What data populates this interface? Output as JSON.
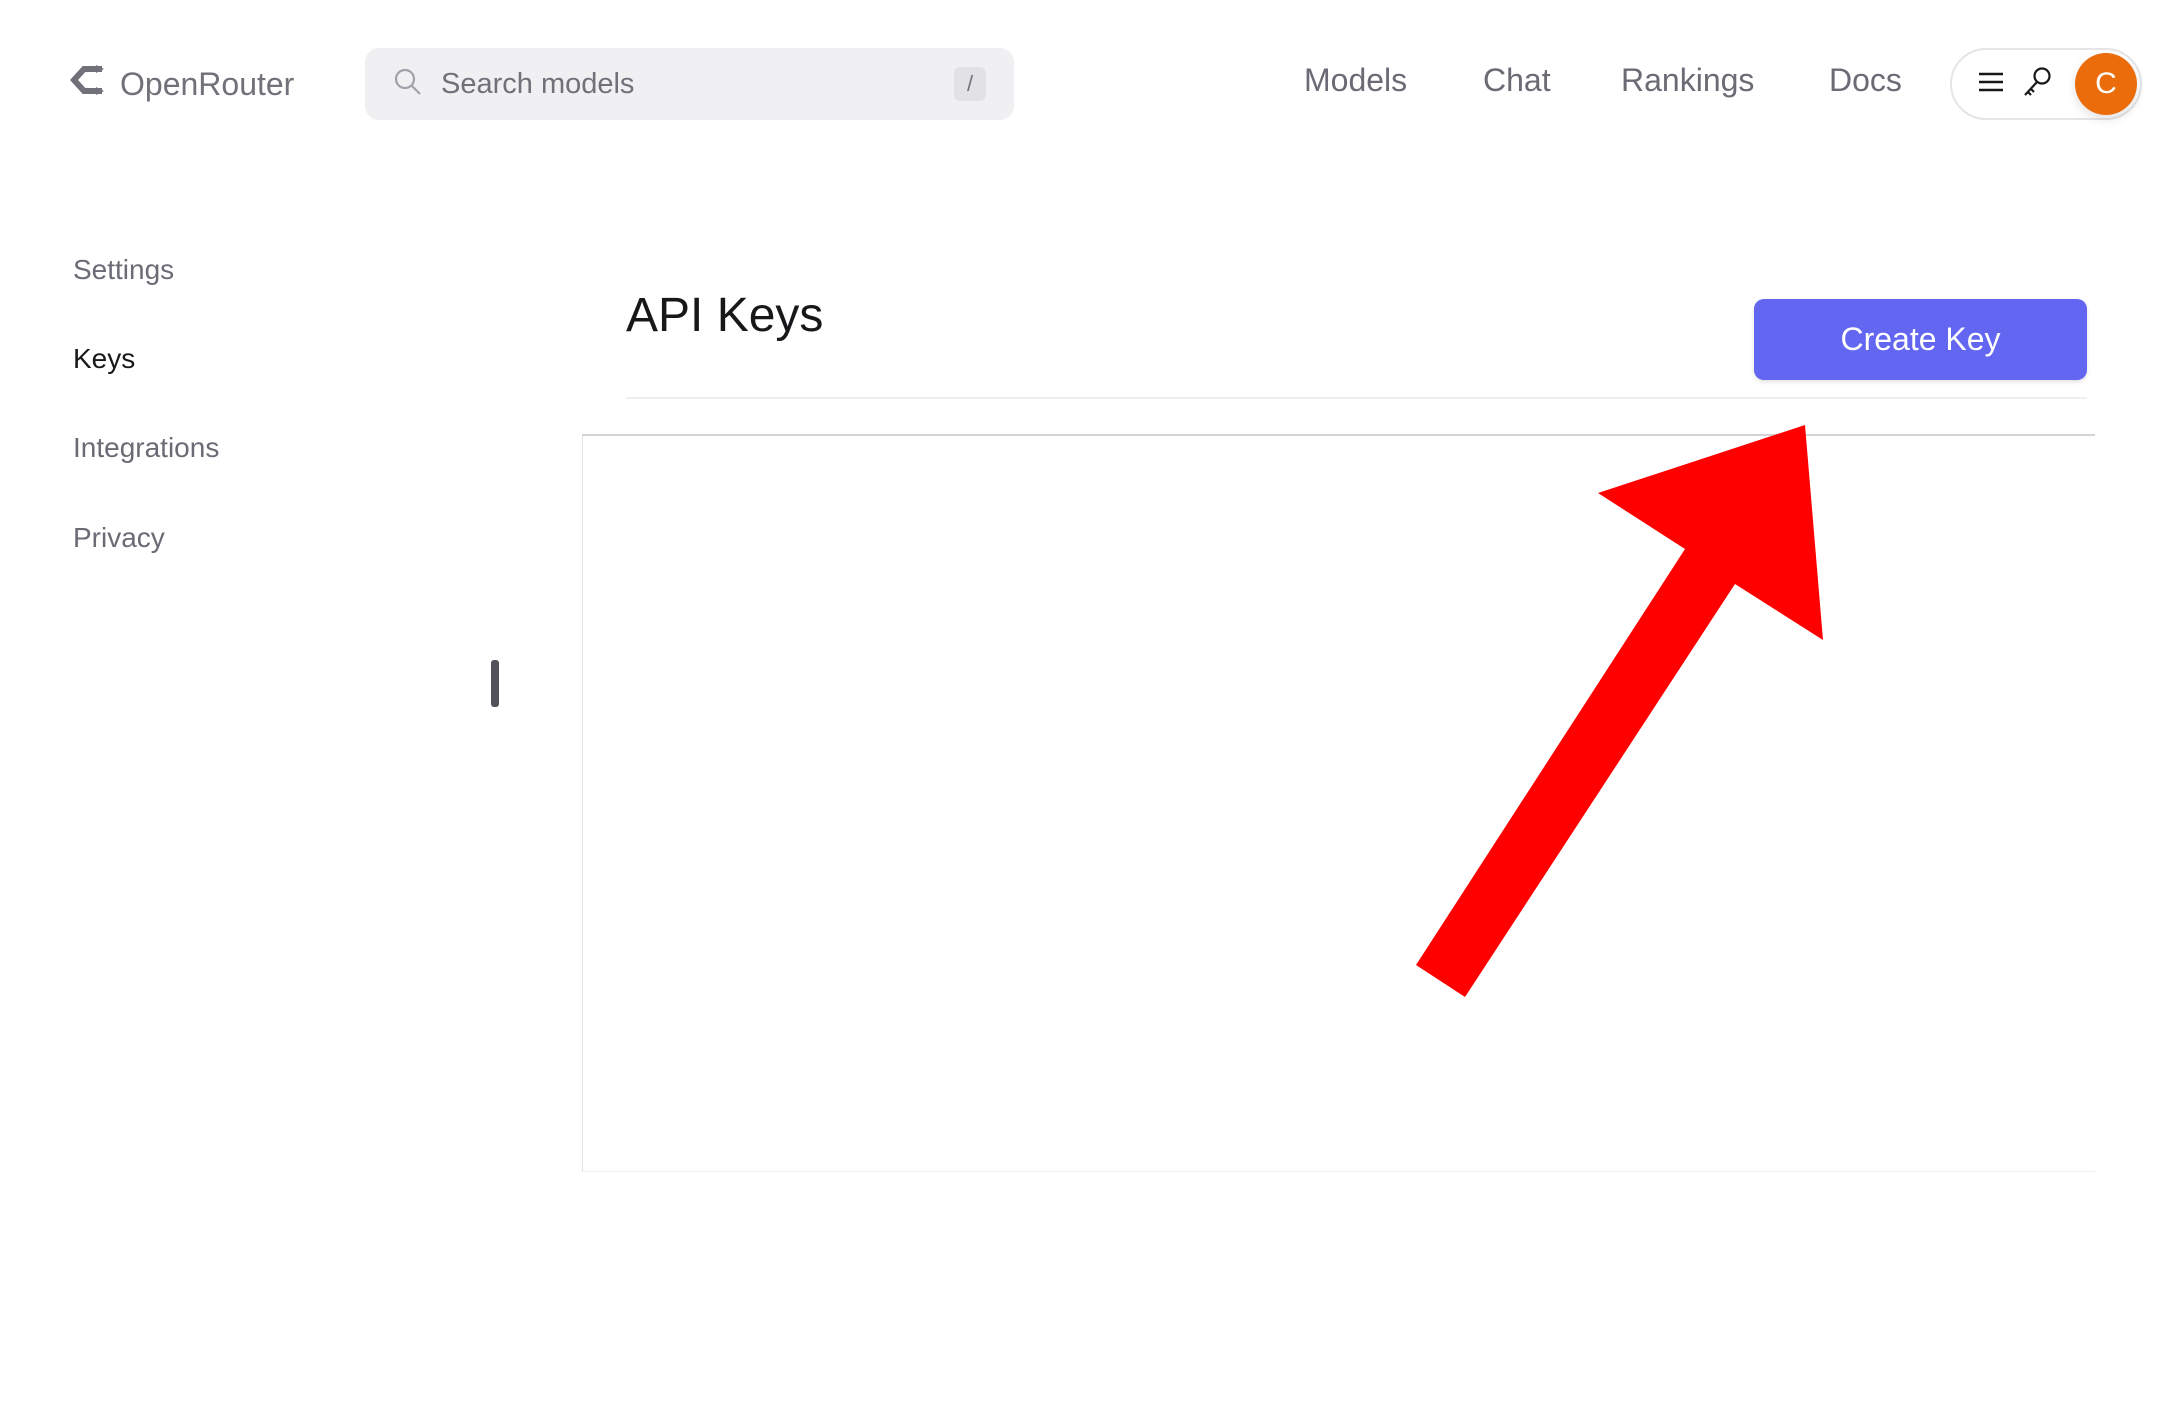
{
  "header": {
    "brand": "OpenRouter",
    "search": {
      "placeholder": "Search models",
      "shortcut": "/"
    },
    "nav": [
      "Models",
      "Chat",
      "Rankings",
      "Docs"
    ],
    "avatar_initial": "C"
  },
  "sidebar": {
    "items": [
      {
        "label": "Settings",
        "active": false
      },
      {
        "label": "Keys",
        "active": true
      },
      {
        "label": "Integrations",
        "active": false
      },
      {
        "label": "Privacy",
        "active": false
      }
    ]
  },
  "main": {
    "title": "API Keys",
    "create_button": "Create Key"
  },
  "colors": {
    "accent": "#6366f1",
    "avatar": "#ea6c0a",
    "annotation_arrow": "#ff0000"
  }
}
